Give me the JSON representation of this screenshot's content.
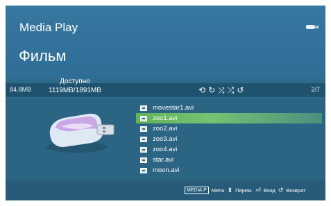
{
  "header": {
    "app_title": "Media Play",
    "section_title": "Фильм",
    "usb_icon": "usb-icon"
  },
  "status": {
    "size": "84.8MB",
    "page": "2/7",
    "mode_icons": [
      "repeat-icon",
      "repeat-one-icon",
      "shuffle-icon",
      "shuffle-repeat-icon",
      "refresh-icon"
    ]
  },
  "device": {
    "icon": "usb-drive-icon",
    "available_label": "Доступно",
    "available_value": "1119MB/1891MB"
  },
  "files": [
    {
      "name": "movestar1.avi",
      "selected": false
    },
    {
      "name": "zoo1.avi",
      "selected": true
    },
    {
      "name": "zoo2.avi",
      "selected": false
    },
    {
      "name": "zoo3.avi",
      "selected": false
    },
    {
      "name": "zoo4.avi",
      "selected": false
    },
    {
      "name": "star.avi",
      "selected": false
    },
    {
      "name": "moon.avi",
      "selected": false
    }
  ],
  "help": {
    "menu_key": "MEDIA.P",
    "menu_label": "Menu",
    "move_label": "Перем.",
    "enter_label": "Вход",
    "return_label": "Возврат"
  },
  "colors": {
    "background": "#2e6a89",
    "selection": "#6dbb66"
  }
}
